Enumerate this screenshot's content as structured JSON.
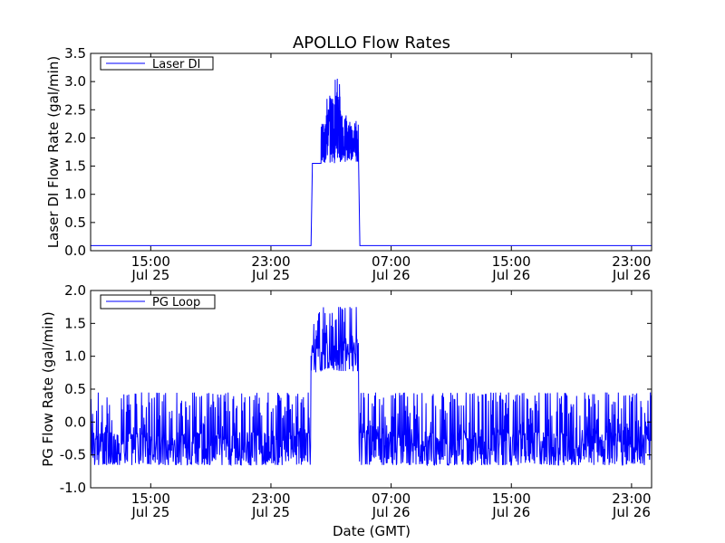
{
  "chart_data": [
    {
      "type": "line",
      "title": "APOLLO Flow Rates",
      "ylabel": "Laser DI Flow Rate (gal/min)",
      "xlabel": "",
      "ylim": [
        0.0,
        3.5
      ],
      "yticks": [
        "0.0",
        "0.5",
        "1.0",
        "1.5",
        "2.0",
        "2.5",
        "3.0",
        "3.5"
      ],
      "xlim": [
        "2011-07-25 11:00",
        "2011-07-27 00:20"
      ],
      "xticks": [
        {
          "time": "2011-07-25 15:00",
          "label1": "15:00",
          "label2": "Jul 25"
        },
        {
          "time": "2011-07-25 23:00",
          "label1": "23:00",
          "label2": "Jul 25"
        },
        {
          "time": "2011-07-26 07:00",
          "label1": "07:00",
          "label2": "Jul 26"
        },
        {
          "time": "2011-07-26 15:00",
          "label1": "15:00",
          "label2": "Jul 26"
        },
        {
          "time": "2011-07-26 23:00",
          "label1": "23:00",
          "label2": "Jul 26"
        }
      ],
      "legend_position": "top-left",
      "grid": false,
      "series": [
        {
          "name": "Laser DI",
          "color": "#0000ff",
          "points": [
            [
              "2011-07-25 11:00",
              0.09
            ],
            [
              "2011-07-26 01:40",
              0.09
            ],
            [
              "2011-07-26 01:45",
              1.42
            ],
            [
              "2011-07-26 01:55",
              1.55
            ],
            [
              "2011-07-26 02:20",
              1.55
            ],
            [
              "2011-07-26 02:30",
              2.25
            ],
            [
              "2011-07-26 02:40",
              1.7
            ],
            [
              "2011-07-26 02:55",
              2.75
            ],
            [
              "2011-07-26 03:10",
              1.65
            ],
            [
              "2011-07-26 03:25",
              3.05
            ],
            [
              "2011-07-26 03:40",
              1.6
            ],
            [
              "2011-07-26 04:00",
              2.4
            ],
            [
              "2011-07-26 04:20",
              1.6
            ],
            [
              "2011-07-26 04:40",
              2.3
            ],
            [
              "2011-07-26 04:50",
              1.55
            ],
            [
              "2011-07-26 04:55",
              0.09
            ],
            [
              "2011-07-27 00:20",
              0.09
            ]
          ]
        }
      ]
    },
    {
      "type": "line",
      "title": "",
      "ylabel": "PG Flow Rate (gal/min)",
      "xlabel": "Date (GMT)",
      "ylim": [
        -1.0,
        2.0
      ],
      "yticks": [
        "-1.0",
        "-0.5",
        "0.0",
        "0.5",
        "1.0",
        "1.5",
        "2.0"
      ],
      "xlim": [
        "2011-07-25 11:00",
        "2011-07-27 00:20"
      ],
      "xticks": [
        {
          "time": "2011-07-25 15:00",
          "label1": "15:00",
          "label2": "Jul 25"
        },
        {
          "time": "2011-07-25 23:00",
          "label1": "23:00",
          "label2": "Jul 25"
        },
        {
          "time": "2011-07-26 07:00",
          "label1": "07:00",
          "label2": "Jul 26"
        },
        {
          "time": "2011-07-26 15:00",
          "label1": "15:00",
          "label2": "Jul 26"
        },
        {
          "time": "2011-07-26 23:00",
          "label1": "23:00",
          "label2": "Jul 26"
        }
      ],
      "legend_position": "top-left",
      "grid": false,
      "series": [
        {
          "name": "PG Loop",
          "color": "#0000ff",
          "points": [
            [
              "2011-07-25 11:00",
              -0.2
            ],
            [
              "2011-07-26 01:40",
              -0.2
            ],
            [
              "2011-07-26 01:55",
              0.6
            ],
            [
              "2011-07-26 02:30",
              1.2
            ],
            [
              "2011-07-26 03:30",
              1.15
            ],
            [
              "2011-07-26 04:30",
              1.3
            ],
            [
              "2011-07-26 04:45",
              0.2
            ],
            [
              "2011-07-26 05:00",
              -0.2
            ],
            [
              "2011-07-27 00:20",
              -0.2
            ]
          ],
          "fluctuation": {
            "baseline_low": -0.85,
            "baseline_high": 0.45,
            "active_low": 0.6,
            "active_high": 1.75,
            "active_start": "2011-07-26 01:40",
            "active_end": "2011-07-26 04:50"
          }
        }
      ]
    }
  ]
}
